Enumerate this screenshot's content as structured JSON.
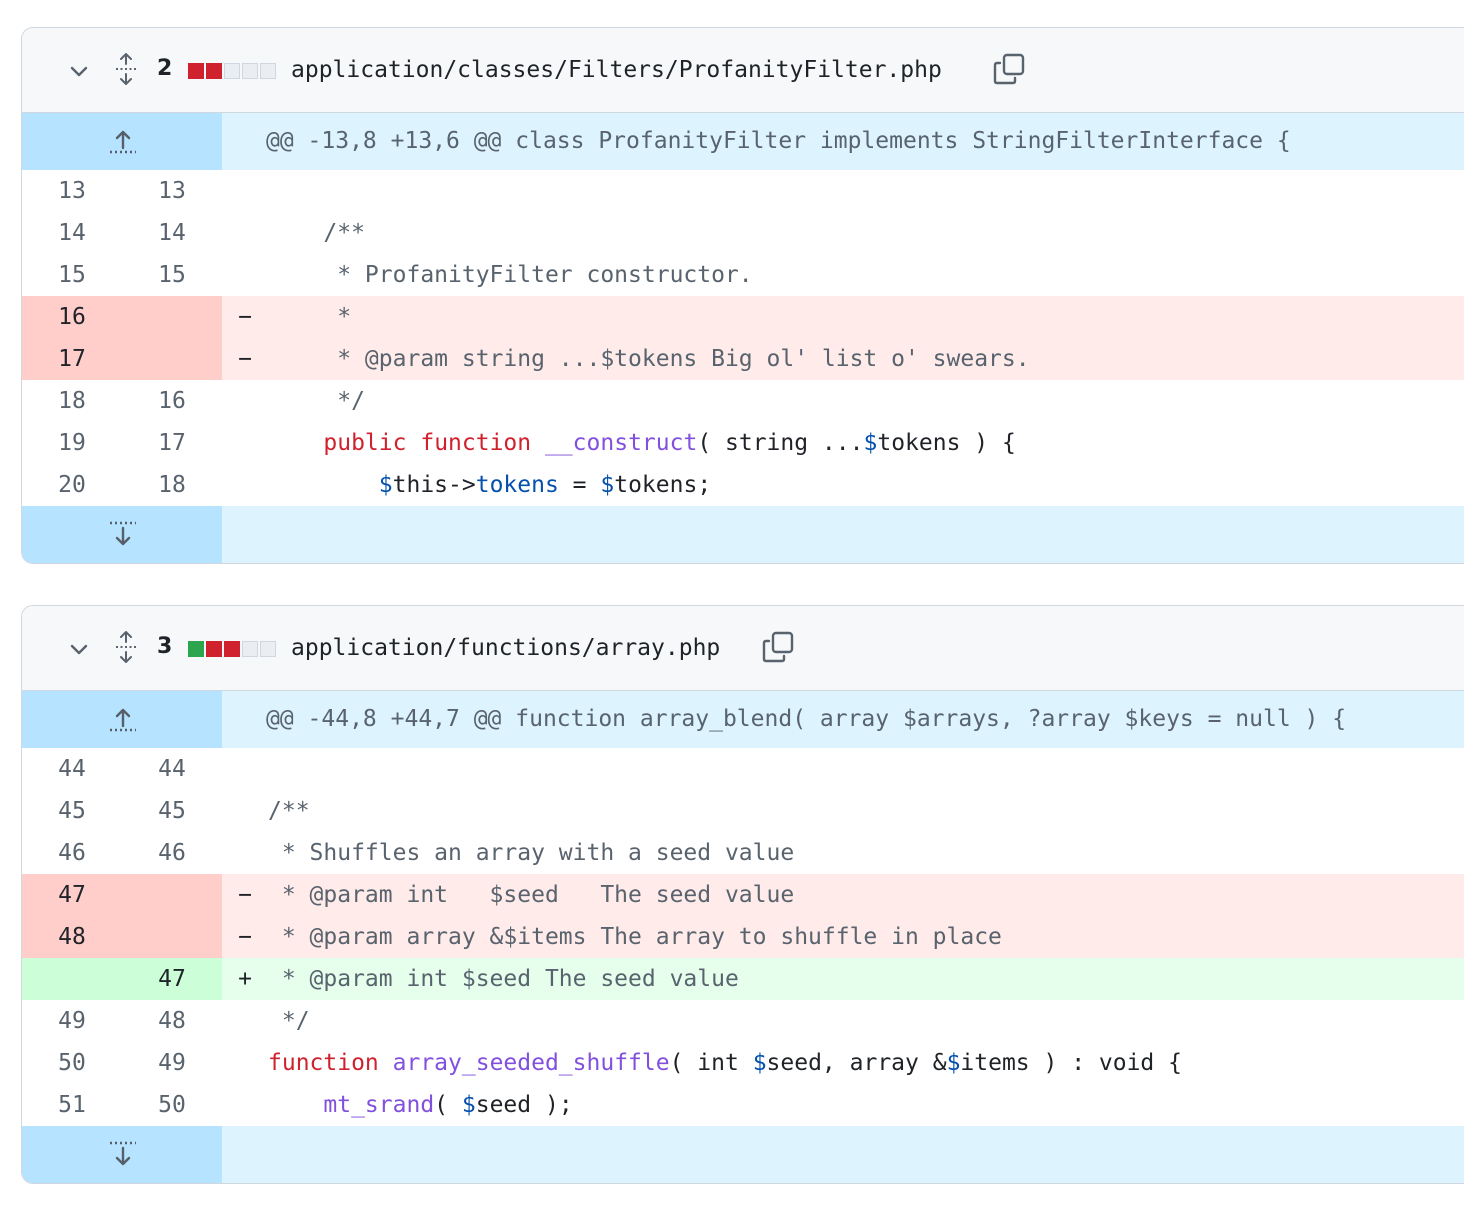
{
  "files": [
    {
      "change_count": "2",
      "path": "application/classes/Filters/ProfanityFilter.php",
      "hunk_header": "@@ -13,8 +13,6 @@ class ProfanityFilter implements StringFilterInterface {",
      "diffstat": [
        "del",
        "del",
        "neu",
        "neu",
        "neu"
      ],
      "lines": [
        {
          "old": "13",
          "new": "13",
          "sign": "",
          "type": "ctx",
          "tokens": []
        },
        {
          "old": "14",
          "new": "14",
          "sign": "",
          "type": "ctx",
          "tokens": [
            {
              "t": "    /**",
              "c": "cm"
            }
          ]
        },
        {
          "old": "15",
          "new": "15",
          "sign": "",
          "type": "ctx",
          "tokens": [
            {
              "t": "     * ProfanityFilter constructor.",
              "c": "cm"
            }
          ]
        },
        {
          "old": "16",
          "new": "",
          "sign": "−",
          "type": "del",
          "tokens": [
            {
              "t": "     *",
              "c": "cm"
            }
          ]
        },
        {
          "old": "17",
          "new": "",
          "sign": "−",
          "type": "del",
          "tokens": [
            {
              "t": "     * @param string ...$tokens Big ol' list o' swears.",
              "c": "cm"
            }
          ]
        },
        {
          "old": "18",
          "new": "16",
          "sign": "",
          "type": "ctx",
          "tokens": [
            {
              "t": "     */",
              "c": "cm"
            }
          ]
        },
        {
          "old": "19",
          "new": "17",
          "sign": "",
          "type": "ctx",
          "tokens": [
            {
              "t": "    ",
              "c": ""
            },
            {
              "t": "public",
              "c": "kw"
            },
            {
              "t": " ",
              "c": ""
            },
            {
              "t": "function",
              "c": "kw"
            },
            {
              "t": " ",
              "c": ""
            },
            {
              "t": "__construct",
              "c": "fn"
            },
            {
              "t": "( string ...",
              "c": ""
            },
            {
              "t": "$",
              "c": "var"
            },
            {
              "t": "tokens ) {",
              "c": ""
            }
          ]
        },
        {
          "old": "20",
          "new": "18",
          "sign": "",
          "type": "ctx",
          "tokens": [
            {
              "t": "        ",
              "c": ""
            },
            {
              "t": "$",
              "c": "var"
            },
            {
              "t": "this->",
              "c": ""
            },
            {
              "t": "tokens",
              "c": "var"
            },
            {
              "t": " = ",
              "c": ""
            },
            {
              "t": "$",
              "c": "var"
            },
            {
              "t": "tokens;",
              "c": ""
            }
          ]
        }
      ]
    },
    {
      "change_count": "3",
      "path": "application/functions/array.php",
      "hunk_header": "@@ -44,8 +44,7 @@ function array_blend( array $arrays, ?array $keys = null ) {",
      "diffstat": [
        "add",
        "del",
        "del",
        "neu",
        "neu"
      ],
      "lines": [
        {
          "old": "44",
          "new": "44",
          "sign": "",
          "type": "ctx",
          "tokens": []
        },
        {
          "old": "45",
          "new": "45",
          "sign": "",
          "type": "ctx",
          "tokens": [
            {
              "t": "/**",
              "c": "cm"
            }
          ]
        },
        {
          "old": "46",
          "new": "46",
          "sign": "",
          "type": "ctx",
          "tokens": [
            {
              "t": " * Shuffles an array with a seed value",
              "c": "cm"
            }
          ]
        },
        {
          "old": "47",
          "new": "",
          "sign": "−",
          "type": "del",
          "tokens": [
            {
              "t": " * @param int   $seed   The seed value",
              "c": "cm"
            }
          ]
        },
        {
          "old": "48",
          "new": "",
          "sign": "−",
          "type": "del",
          "tokens": [
            {
              "t": " * @param array &$items The array to shuffle in place",
              "c": "cm"
            }
          ]
        },
        {
          "old": "",
          "new": "47",
          "sign": "+",
          "type": "add",
          "tokens": [
            {
              "t": " * @param int $seed The seed value",
              "c": "cm"
            }
          ]
        },
        {
          "old": "49",
          "new": "48",
          "sign": "",
          "type": "ctx",
          "tokens": [
            {
              "t": " */",
              "c": "cm"
            }
          ]
        },
        {
          "old": "50",
          "new": "49",
          "sign": "",
          "type": "ctx",
          "tokens": [
            {
              "t": "function",
              "c": "kw"
            },
            {
              "t": " ",
              "c": ""
            },
            {
              "t": "array_seeded_shuffle",
              "c": "fn"
            },
            {
              "t": "( int ",
              "c": ""
            },
            {
              "t": "$",
              "c": "var"
            },
            {
              "t": "seed, array &",
              "c": ""
            },
            {
              "t": "$",
              "c": "var"
            },
            {
              "t": "items ) : void {",
              "c": ""
            }
          ]
        },
        {
          "old": "51",
          "new": "50",
          "sign": "",
          "type": "ctx",
          "tokens": [
            {
              "t": "    ",
              "c": ""
            },
            {
              "t": "mt_srand",
              "c": "fn"
            },
            {
              "t": "( ",
              "c": ""
            },
            {
              "t": "$",
              "c": "var"
            },
            {
              "t": "seed );",
              "c": ""
            }
          ]
        }
      ]
    }
  ]
}
